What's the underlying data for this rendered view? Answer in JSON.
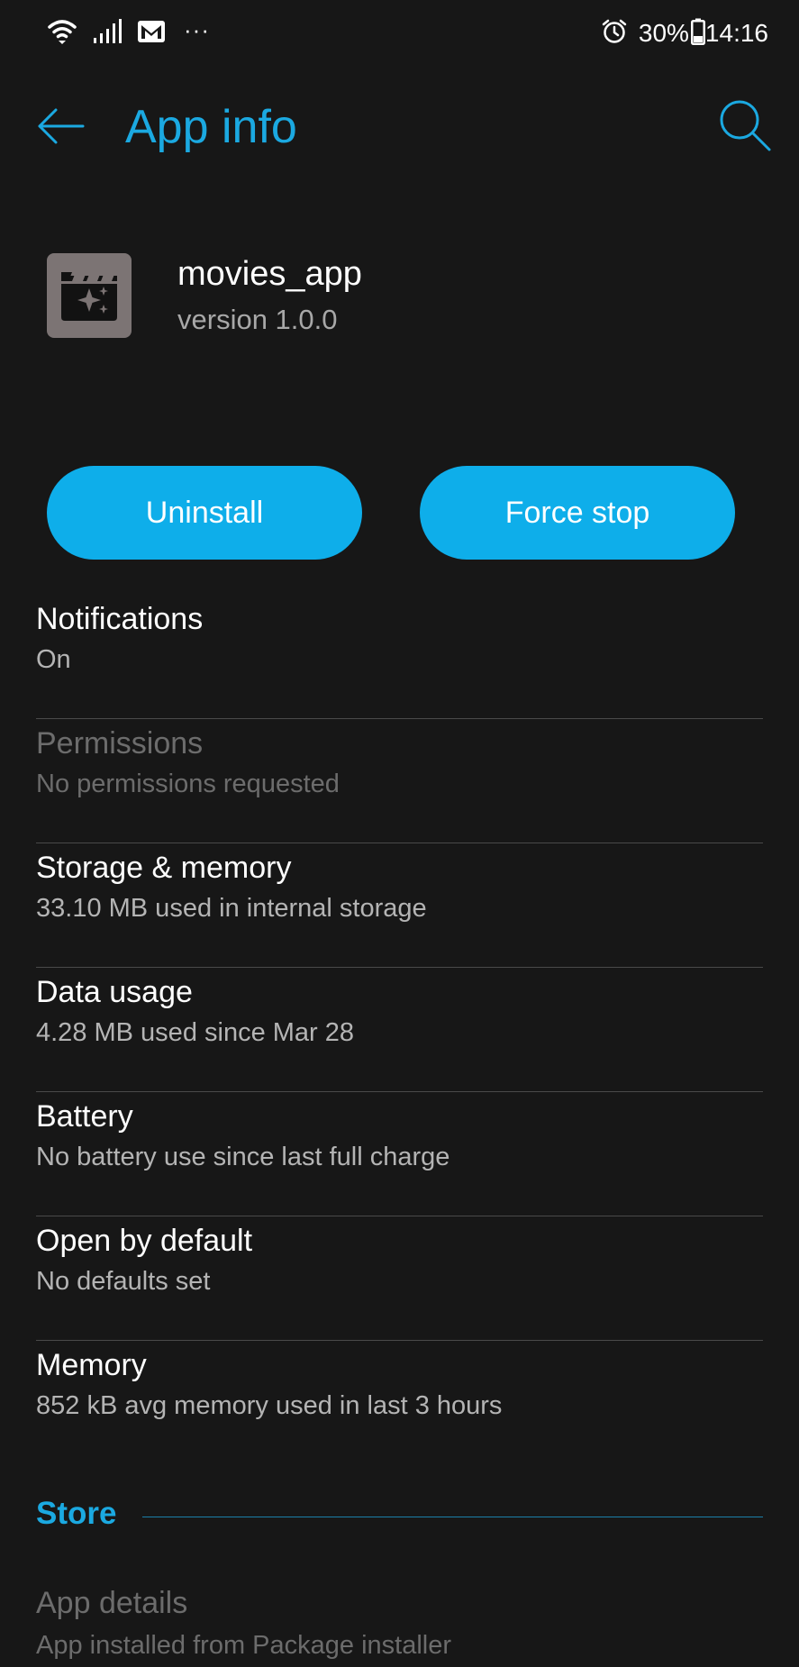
{
  "status_bar": {
    "battery_percent": "30%",
    "time": "14:16",
    "overflow": "···",
    "icons": [
      "wifi-icon",
      "cellular-signal-icon",
      "gmail-icon",
      "alarm-icon",
      "battery-icon"
    ]
  },
  "app_bar": {
    "title": "App info",
    "back_icon": "arrow-left-icon",
    "search_icon": "search-icon",
    "accent_color": "#1ba9e1"
  },
  "app": {
    "name": "movies_app",
    "version": "version 1.0.0",
    "icon": "clapperboard-sparkle-icon"
  },
  "actions": {
    "uninstall_label": "Uninstall",
    "force_stop_label": "Force stop",
    "button_color": "#0eaeea"
  },
  "settings": [
    {
      "title": "Notifications",
      "subtitle": "On",
      "enabled": true
    },
    {
      "title": "Permissions",
      "subtitle": "No permissions requested",
      "enabled": false
    },
    {
      "title": "Storage & memory",
      "subtitle": "33.10 MB used in internal storage",
      "enabled": true
    },
    {
      "title": "Data usage",
      "subtitle": "4.28 MB used since Mar 28",
      "enabled": true
    },
    {
      "title": "Battery",
      "subtitle": "No battery use since last full charge",
      "enabled": true
    },
    {
      "title": "Open by default",
      "subtitle": "No defaults set",
      "enabled": true
    },
    {
      "title": "Memory",
      "subtitle": "852 kB avg memory used in last 3 hours",
      "enabled": true
    }
  ],
  "store": {
    "section_label": "Store",
    "app_details_title": "App details",
    "app_details_subtitle": "App installed from Package installer"
  }
}
